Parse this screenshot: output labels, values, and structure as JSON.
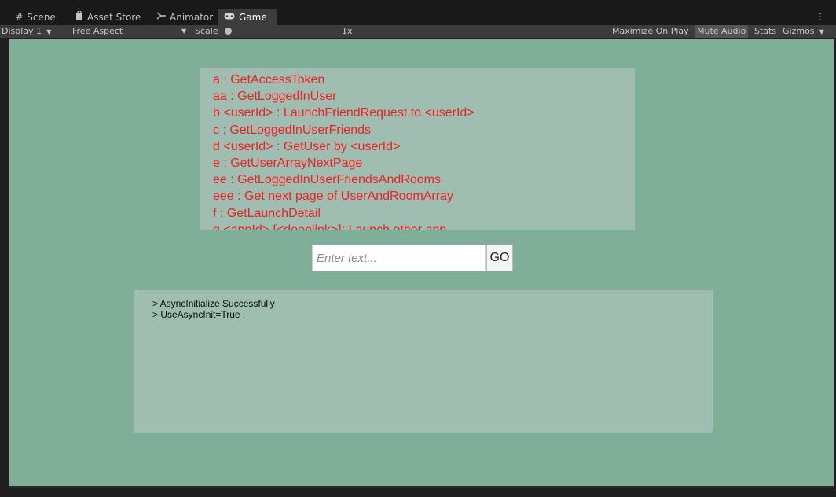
{
  "tabs": [
    {
      "icon": "#",
      "label": "Scene"
    },
    {
      "icon": "▲",
      "label": "Asset Store"
    },
    {
      "icon": "⋟",
      "label": "Animator"
    },
    {
      "icon": "∞",
      "label": "Game"
    }
  ],
  "active_tab": "Game",
  "toolbar": {
    "display": "Display 1",
    "aspect": "Free Aspect",
    "scale_label": "Scale",
    "scale_value": "1x",
    "maximize_on_play": "Maximize On Play",
    "mute_audio": "Mute Audio",
    "stats": "Stats",
    "gizmos": "Gizmos"
  },
  "commands": [
    "a : GetAccessToken",
    "aa : GetLoggedInUser",
    "b <userId> : LaunchFriendRequest to <userId>",
    "c : GetLoggedInUserFriends",
    "d <userId> : GetUser by <userId>",
    "e : GetUserArrayNextPage",
    "ee : GetLoggedInUserFriendsAndRooms",
    "eee : Get next page of UserAndRoomArray",
    "f : GetLaunchDetail",
    "g <appId> [<deeplink>]: Launch other app"
  ],
  "input": {
    "placeholder": "Enter text...",
    "value": ""
  },
  "go_label": "GO",
  "output_lines": [
    "> AsyncInitialize Successfully",
    "> UseAsyncInit=True"
  ],
  "colors": {
    "game_bg": "#7fae99",
    "panel_bg": "#9fbdb1",
    "command_text": "#ee2222"
  }
}
